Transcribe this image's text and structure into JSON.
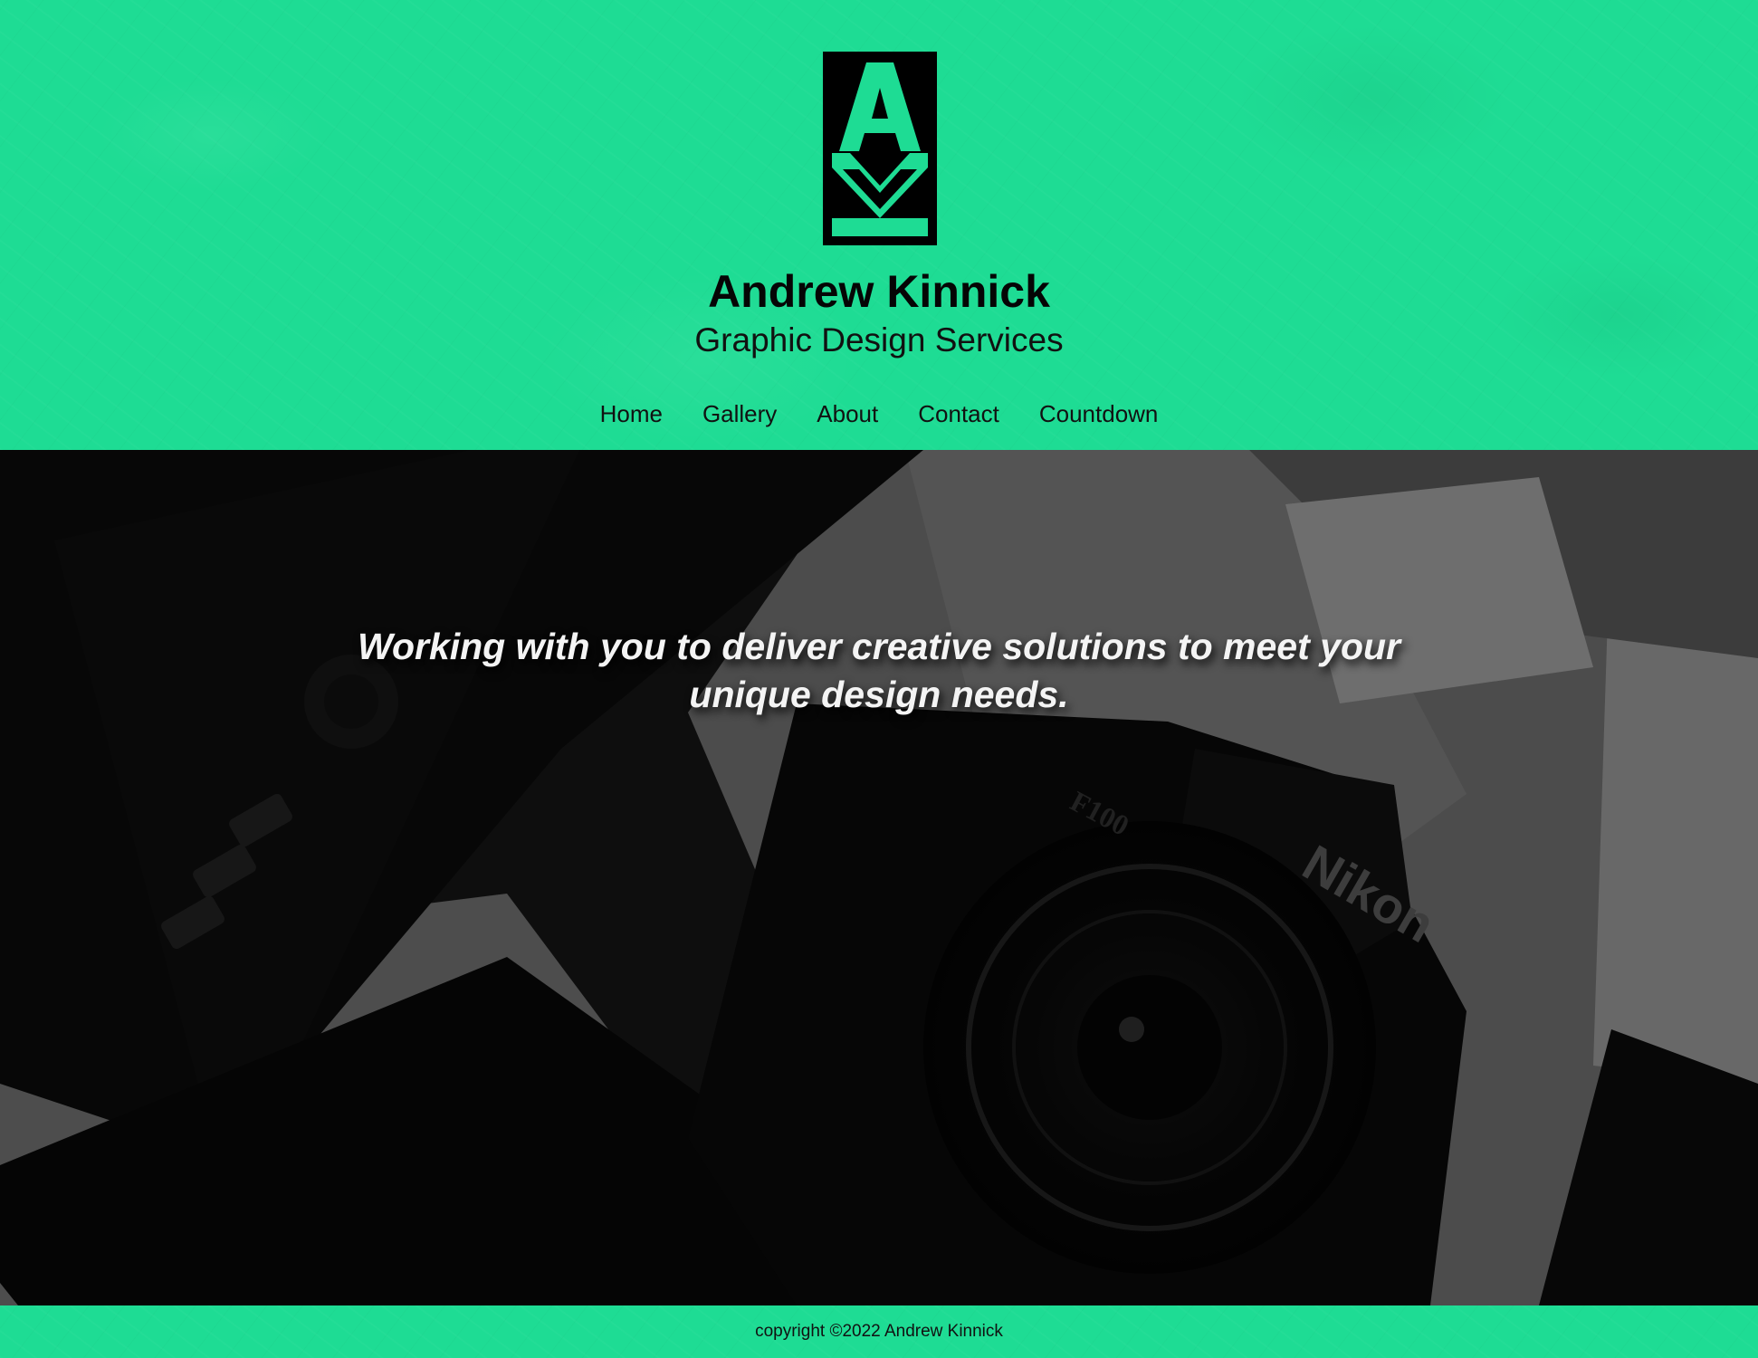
{
  "header": {
    "logo_letters": "AK",
    "title": "Andrew Kinnick",
    "subtitle": "Graphic Design Services"
  },
  "nav": {
    "items": [
      {
        "label": "Home"
      },
      {
        "label": "Gallery"
      },
      {
        "label": "About"
      },
      {
        "label": "Contact"
      },
      {
        "label": "Countdown"
      }
    ]
  },
  "hero": {
    "tagline": "Working with you to deliver creative solutions to meet your unique design needs.",
    "camera_brand": "Nikon",
    "camera_model": "F100"
  },
  "footer": {
    "copyright": "copyright ©2022 Andrew Kinnick"
  },
  "colors": {
    "brand_green": "#1edc94",
    "text_dark": "#050505",
    "hero_text": "#f4f4f4"
  }
}
